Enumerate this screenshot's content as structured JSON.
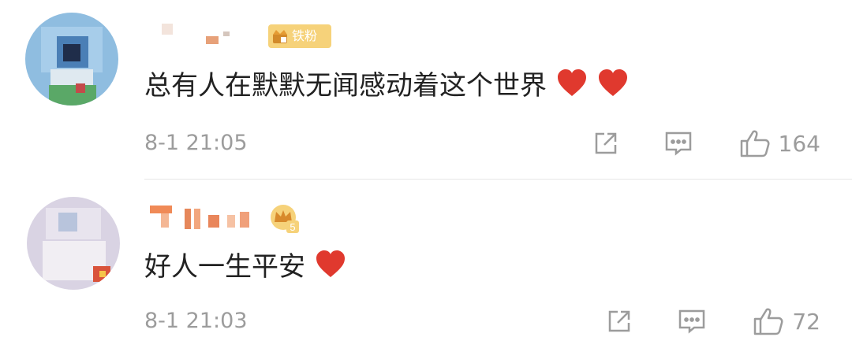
{
  "comments": [
    {
      "badge_text": "铁粉",
      "text": "总有人在默默无闻感动着这个世界",
      "time": "8-1 21:05",
      "like_count": "164"
    },
    {
      "badge_level": "5",
      "text": "好人一生平安",
      "time": "8-1 21:03",
      "like_count": "72"
    }
  ],
  "colors": {
    "text": "#222222",
    "meta": "#9c9c9c",
    "heart": "#e0392e",
    "badge": "#f6d27a"
  },
  "icons": [
    "share-icon",
    "comment-icon",
    "like-icon",
    "heart-icon",
    "crown-icon"
  ]
}
